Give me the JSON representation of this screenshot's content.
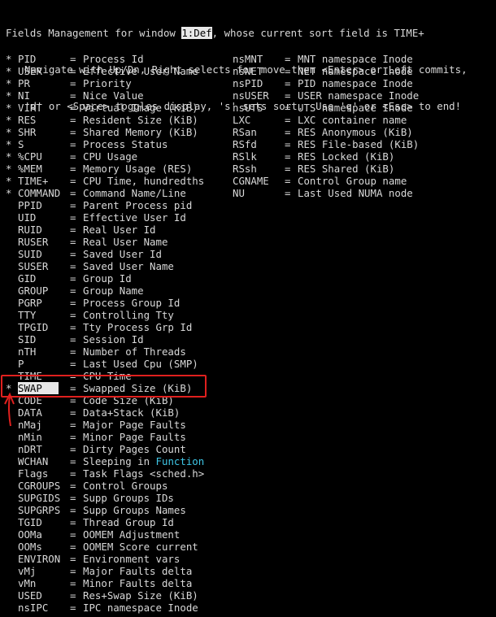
{
  "header": {
    "line1_pre": "Fields Management for window ",
    "window_id": "1:Def",
    "line1_post": ", whose current sort field is TIME+",
    "line2": "Navigate with Up/Dn, Right selects for move then <Enter> or Left commits,",
    "line3": "'d' or <Space> toggles display, 's' sets sort.  Use 'q' or <Esc> to end!"
  },
  "fields_left": [
    {
      "star": "*",
      "name": "PID",
      "desc": "Process Id"
    },
    {
      "star": "*",
      "name": "USER",
      "desc": "Effective User Name"
    },
    {
      "star": "*",
      "name": "PR",
      "desc": "Priority"
    },
    {
      "star": "*",
      "name": "NI",
      "desc": "Nice Value"
    },
    {
      "star": "*",
      "name": "VIRT",
      "desc": "Virtual Image (KiB)"
    },
    {
      "star": "*",
      "name": "RES",
      "desc": "Resident Size (KiB)"
    },
    {
      "star": "*",
      "name": "SHR",
      "desc": "Shared Memory (KiB)"
    },
    {
      "star": "*",
      "name": "S",
      "desc": "Process Status"
    },
    {
      "star": "*",
      "name": "%CPU",
      "desc": "CPU Usage"
    },
    {
      "star": "*",
      "name": "%MEM",
      "desc": "Memory Usage (RES)"
    },
    {
      "star": "*",
      "name": "TIME+",
      "desc": "CPU Time, hundredths"
    },
    {
      "star": "*",
      "name": "COMMAND",
      "desc": "Command Name/Line"
    },
    {
      "star": "",
      "name": "PPID",
      "desc": "Parent Process pid"
    },
    {
      "star": "",
      "name": "UID",
      "desc": "Effective User Id"
    },
    {
      "star": "",
      "name": "RUID",
      "desc": "Real User Id"
    },
    {
      "star": "",
      "name": "RUSER",
      "desc": "Real User Name"
    },
    {
      "star": "",
      "name": "SUID",
      "desc": "Saved User Id"
    },
    {
      "star": "",
      "name": "SUSER",
      "desc": "Saved User Name"
    },
    {
      "star": "",
      "name": "GID",
      "desc": "Group Id"
    },
    {
      "star": "",
      "name": "GROUP",
      "desc": "Group Name"
    },
    {
      "star": "",
      "name": "PGRP",
      "desc": "Process Group Id"
    },
    {
      "star": "",
      "name": "TTY",
      "desc": "Controlling Tty"
    },
    {
      "star": "",
      "name": "TPGID",
      "desc": "Tty Process Grp Id"
    },
    {
      "star": "",
      "name": "SID",
      "desc": "Session Id"
    },
    {
      "star": "",
      "name": "nTH",
      "desc": "Number of Threads"
    },
    {
      "star": "",
      "name": "P",
      "desc": "Last Used Cpu (SMP)"
    },
    {
      "star": "",
      "name": "TIME",
      "desc": "CPU Time"
    },
    {
      "star": "*",
      "name": "SWAP",
      "desc": "Swapped Size (KiB)",
      "selected": true
    },
    {
      "star": "",
      "name": "CODE",
      "desc": "Code Size (KiB)"
    },
    {
      "star": "",
      "name": "DATA",
      "desc": "Data+Stack (KiB)"
    },
    {
      "star": "",
      "name": "nMaj",
      "desc": "Major Page Faults"
    },
    {
      "star": "",
      "name": "nMin",
      "desc": "Minor Page Faults"
    },
    {
      "star": "",
      "name": "nDRT",
      "desc": "Dirty Pages Count"
    },
    {
      "star": "",
      "name": "WCHAN",
      "desc_pre": "Sleeping in ",
      "desc_accent": "Function"
    },
    {
      "star": "",
      "name": "Flags",
      "desc": "Task Flags <sched.h>"
    },
    {
      "star": "",
      "name": "CGROUPS",
      "desc": "Control Groups"
    },
    {
      "star": "",
      "name": "SUPGIDS",
      "desc": "Supp Groups IDs"
    },
    {
      "star": "",
      "name": "SUPGRPS",
      "desc": "Supp Groups Names"
    },
    {
      "star": "",
      "name": "TGID",
      "desc": "Thread Group Id"
    },
    {
      "star": "",
      "name": "OOMa",
      "desc": "OOMEM Adjustment"
    },
    {
      "star": "",
      "name": "OOMs",
      "desc": "OOMEM Score current"
    },
    {
      "star": "",
      "name": "ENVIRON",
      "desc": "Environment vars"
    },
    {
      "star": "",
      "name": "vMj",
      "desc": "Major Faults delta"
    },
    {
      "star": "",
      "name": "vMn",
      "desc": "Minor Faults delta"
    },
    {
      "star": "",
      "name": "USED",
      "desc": "Res+Swap Size (KiB)"
    },
    {
      "star": "",
      "name": "nsIPC",
      "desc": "IPC namespace Inode"
    }
  ],
  "fields_right": [
    {
      "name": "nsMNT",
      "desc": "MNT namespace Inode"
    },
    {
      "name": "nsNET",
      "desc": "NET namespace Inode"
    },
    {
      "name": "nsPID",
      "desc": "PID namespace Inode"
    },
    {
      "name": "nsUSER",
      "desc": "USER namespace Inode"
    },
    {
      "name": "nsUTS",
      "desc": "UTS namespace Inode"
    },
    {
      "name": "LXC",
      "desc": "LXC container name"
    },
    {
      "name": "RSan",
      "desc": "RES Anonymous (KiB)"
    },
    {
      "name": "RSfd",
      "desc": "RES File-based (KiB)"
    },
    {
      "name": "RSlk",
      "desc": "RES Locked (KiB)"
    },
    {
      "name": "RSsh",
      "desc": "RES Shared (KiB)"
    },
    {
      "name": "CGNAME",
      "desc": "Control Group name"
    },
    {
      "name": "NU",
      "desc": "Last Used NUMA node"
    }
  ],
  "eq": "=",
  "colors": {
    "background": "#000000",
    "text": "#d8d8d8",
    "highlight": "#e8e8e8",
    "accent": "#3ec6e6",
    "annotation": "#e0201e"
  }
}
